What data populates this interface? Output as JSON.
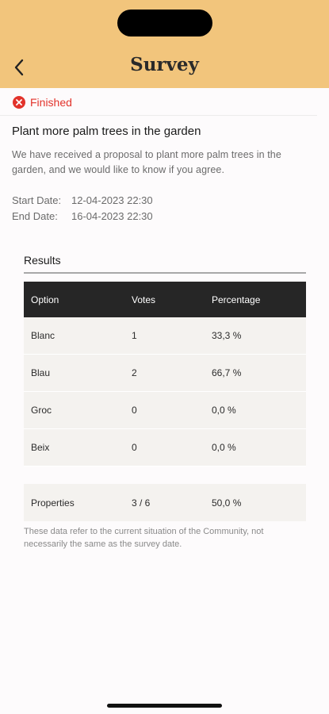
{
  "header": {
    "title": "Survey"
  },
  "status": {
    "label": "Finished"
  },
  "survey": {
    "title": "Plant more palm trees in the garden",
    "description": "We have received a proposal to plant more palm trees in the garden, and we would like to know if you agree.",
    "start_label": "Start Date:",
    "start_value": "12-04-2023 22:30",
    "end_label": "End Date:",
    "end_value": "16-04-2023 22:30"
  },
  "results": {
    "heading": "Results",
    "columns": [
      "Option",
      "Votes",
      "Percentage"
    ],
    "rows": [
      {
        "option": "Blanc",
        "votes": "1",
        "percentage": "33,3 %"
      },
      {
        "option": "Blau",
        "votes": "2",
        "percentage": "66,7 %"
      },
      {
        "option": "Groc",
        "votes": "0",
        "percentage": "0,0 %"
      },
      {
        "option": "Beix",
        "votes": "0",
        "percentage": "0,0 %"
      }
    ],
    "properties": {
      "label": "Properties",
      "votes": "3 / 6",
      "percentage": "50,0 %"
    },
    "note": "These data refer to the current situation of the Community, not necessarily the same as the survey date."
  },
  "colors": {
    "header_bg": "#f2c57c",
    "status_red": "#e2332b",
    "table_header": "#262626"
  }
}
